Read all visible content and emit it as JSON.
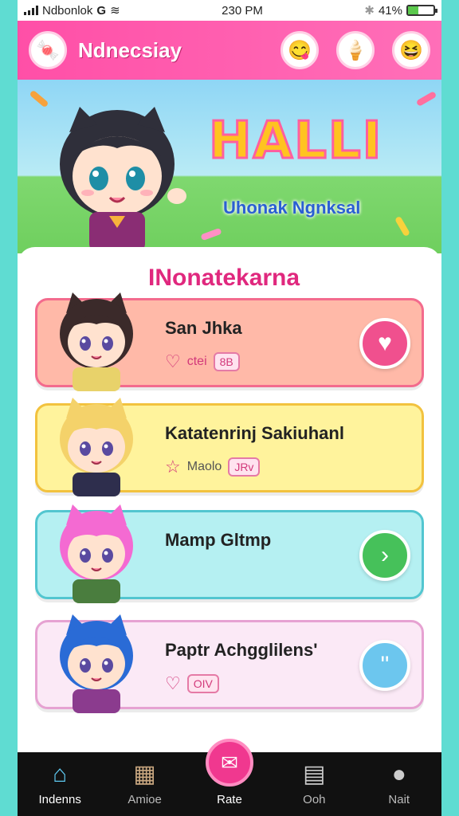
{
  "status_bar": {
    "carrier": "Ndbonlok",
    "carrier_g": "G",
    "time": "230 PM",
    "battery_text": "41%",
    "battery_level": 0.41
  },
  "header": {
    "title": "Ndnecsiay",
    "logo_icon": "🍬",
    "buttons": [
      {
        "icon": "😋",
        "name": "chat-face-icon"
      },
      {
        "icon": "🍦",
        "name": "treat-icon"
      },
      {
        "icon": "😆",
        "name": "laugh-face-icon"
      }
    ]
  },
  "banner": {
    "title": "HALLI",
    "subtitle": "Uhonak Ngnksal"
  },
  "section": {
    "title": "INonatekarna"
  },
  "cards": [
    {
      "name": "San Jhka",
      "sub_icon": "♡",
      "sub_text": "ctei",
      "sub_pill": "8B",
      "action_icon": "♥",
      "bg": "#ffb9a8",
      "border": "#f36b8d",
      "action_color": "#f0508e",
      "hair": "#3b2a2a",
      "shirt": "#e8d26a"
    },
    {
      "name": "Katatenrinj Sakiuhanl",
      "sub_icon": "☆",
      "sub_text": "Maolo",
      "sub_pill": "JRv",
      "action_icon": "",
      "bg": "#fff39c",
      "border": "#f2c23e",
      "action_color": "",
      "hair": "#f4d26a",
      "shirt": "#2e2e4d"
    },
    {
      "name": "Mamp Gltmp",
      "sub_icon": "",
      "sub_text": "",
      "sub_pill": "",
      "action_icon": "›",
      "bg": "#b5f0f2",
      "border": "#52c6d0",
      "action_color": "#46c15a",
      "hair": "#f46ad2",
      "shirt": "#4a7d3e"
    },
    {
      "name": "Paptr Achgglilens'",
      "sub_icon": "♡",
      "sub_text": "",
      "sub_pill": "OIV",
      "action_icon": "\"",
      "bg": "#fbe9f6",
      "border": "#e6a2d2",
      "action_color": "#6cc6ee",
      "hair": "#2a6bd6",
      "shirt": "#8b3b8e"
    }
  ],
  "bottom_nav": [
    {
      "label": "Indenns",
      "icon": "⌂",
      "name": "home"
    },
    {
      "label": "Amioe",
      "icon": "▦",
      "name": "anime"
    },
    {
      "label": "Rate",
      "icon": "✉",
      "name": "rate",
      "center": true
    },
    {
      "label": "Ooh",
      "icon": "▤",
      "name": "ooh"
    },
    {
      "label": "Nait",
      "icon": "●",
      "name": "profile"
    }
  ]
}
